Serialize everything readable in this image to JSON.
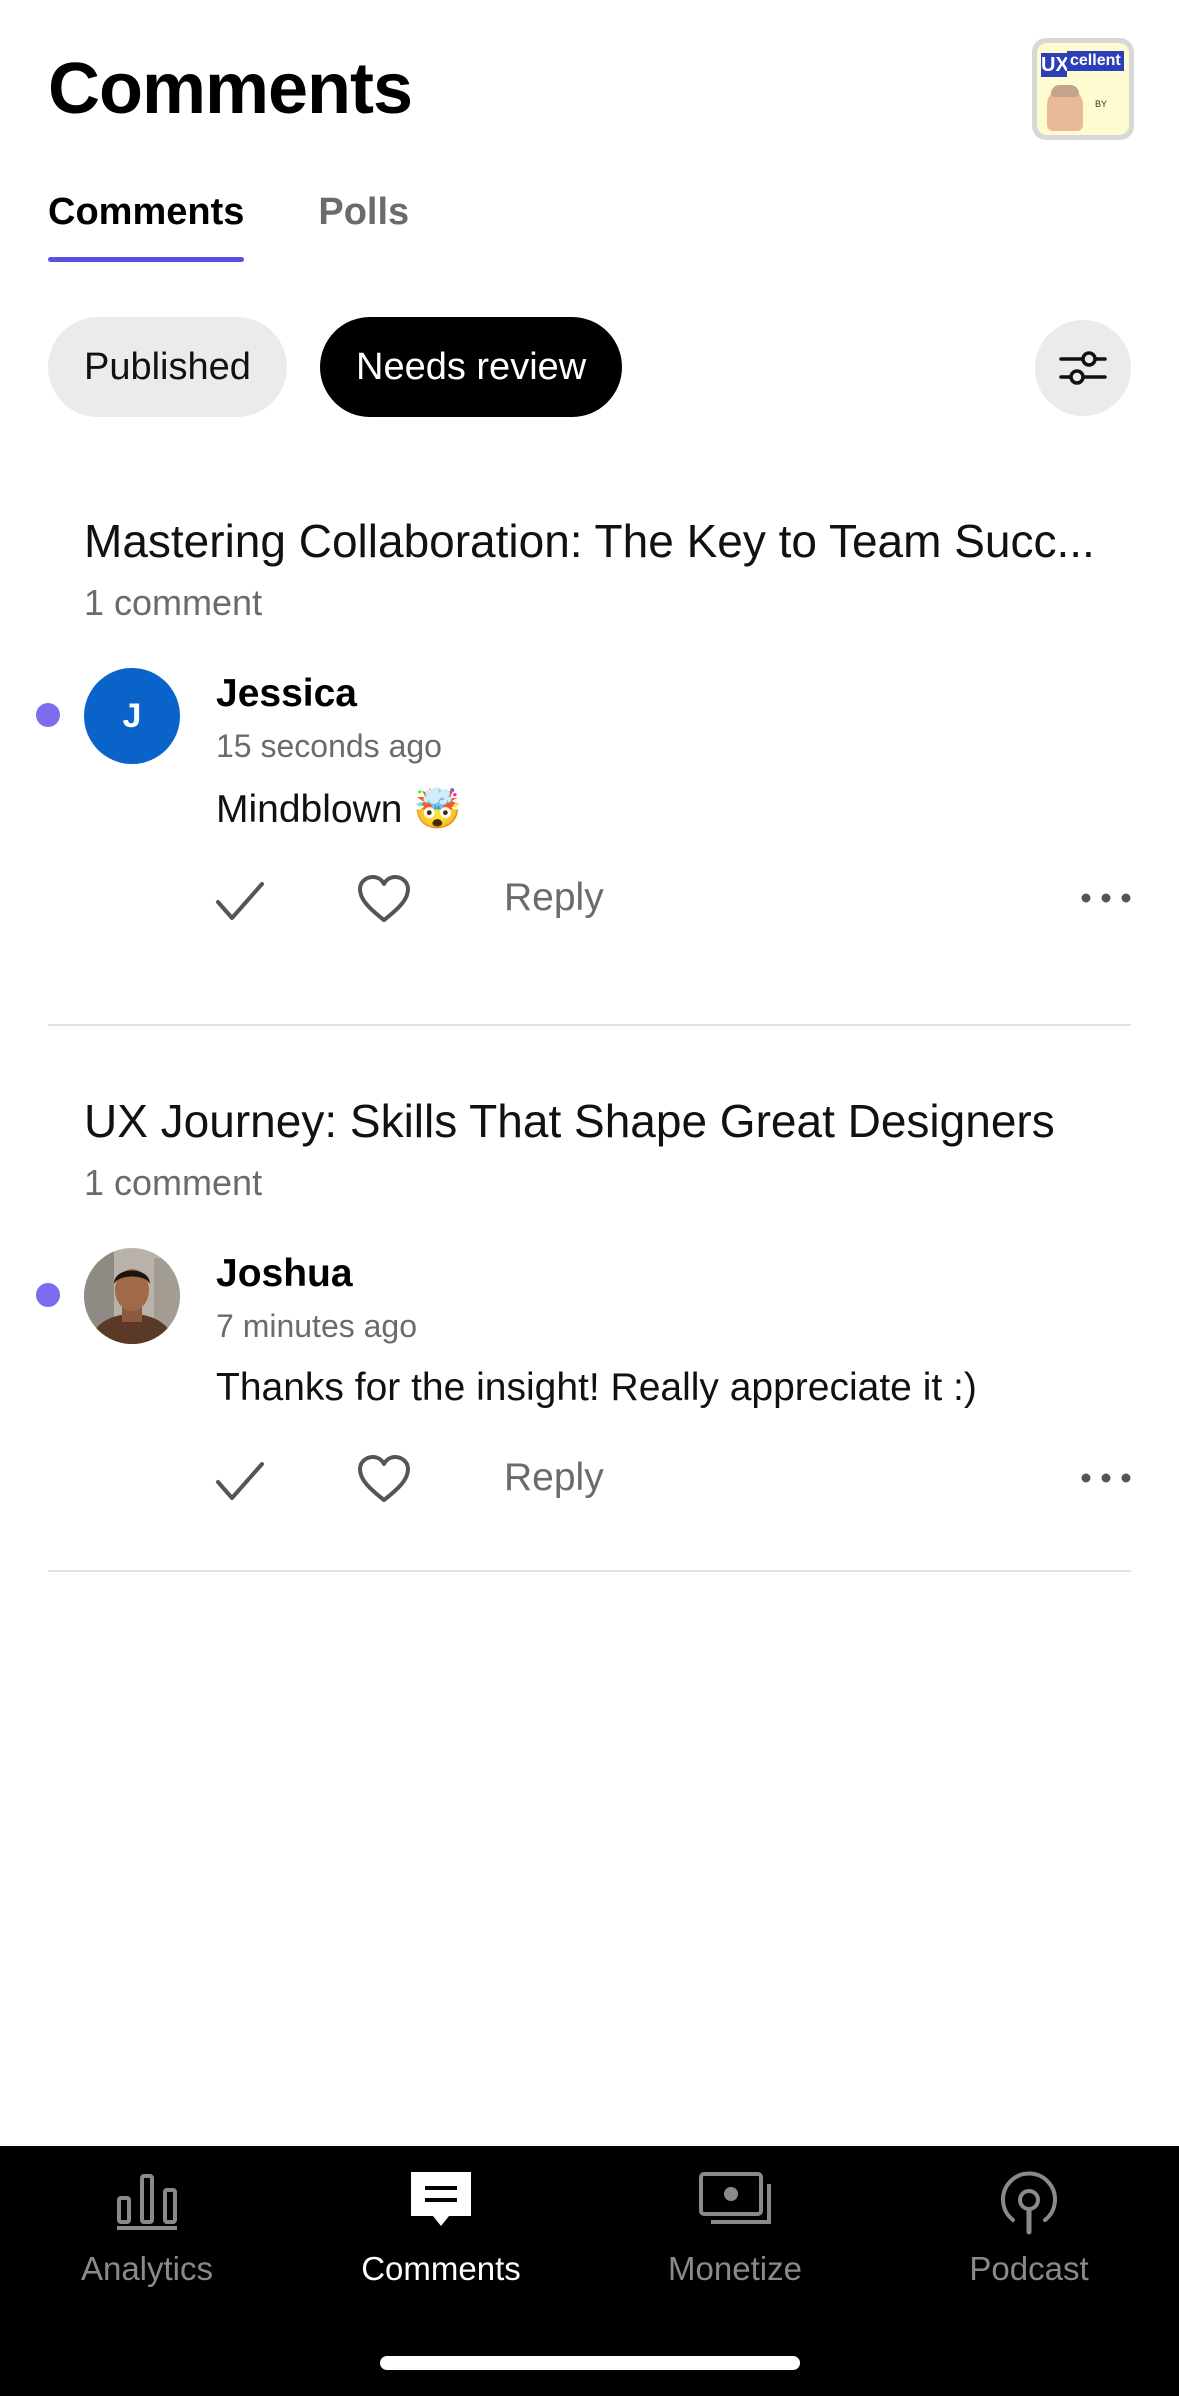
{
  "header": {
    "title": "Comments"
  },
  "tabs": [
    {
      "label": "Comments",
      "active": true
    },
    {
      "label": "Polls",
      "active": false
    }
  ],
  "filters": {
    "published_label": "Published",
    "needs_review_label": "Needs review",
    "selected": "Needs review"
  },
  "posts": [
    {
      "title": "Mastering Collaboration: The Key to Team Succ...",
      "count": "1 comment",
      "comment": {
        "author": "Jessica",
        "avatar_initial": "J",
        "time": "15 seconds ago",
        "text": "Mindblown 🤯",
        "reply_label": "Reply"
      }
    },
    {
      "title": "UX Journey: Skills That Shape Great Designers",
      "count": "1 comment",
      "comment": {
        "author": "Joshua",
        "time": "7 minutes ago",
        "text": "Thanks for the insight! Really appreciate it :)",
        "reply_label": "Reply"
      }
    }
  ],
  "logo": {
    "text_ux": "UX",
    "text_cellent": "cellent",
    "text_by": "BY"
  },
  "bottom_nav": [
    {
      "label": "Analytics",
      "icon": "analytics-icon",
      "active": false
    },
    {
      "label": "Comments",
      "icon": "comments-icon",
      "active": true
    },
    {
      "label": "Monetize",
      "icon": "monetize-icon",
      "active": false
    },
    {
      "label": "Podcast",
      "icon": "podcast-icon",
      "active": false
    }
  ],
  "colors": {
    "accent": "#5b50e6",
    "unread_dot": "#7b6cf0",
    "avatar_blue": "#0a63c9"
  }
}
